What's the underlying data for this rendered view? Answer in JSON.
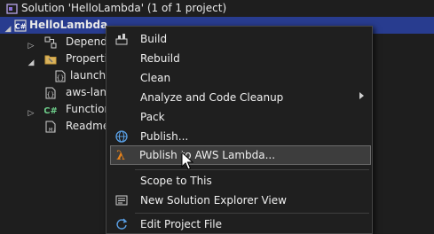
{
  "solution_explorer": {
    "solution_row": "Solution 'HelloLambda' (1 of 1 project)",
    "project_row": "HelloLambda",
    "items": [
      {
        "label": "Dependencies",
        "icon": "dependencies-icon"
      },
      {
        "label": "Properties",
        "icon": "properties-folder-icon"
      },
      {
        "label": "launchSettings.json",
        "icon": "json-file-icon"
      },
      {
        "label": "aws-lambda-tools-defaults.json",
        "icon": "json-file-icon"
      },
      {
        "label": "Function.cs",
        "icon": "csharp-file-icon"
      },
      {
        "label": "Readme.md",
        "icon": "markdown-file-icon"
      }
    ]
  },
  "context_menu": {
    "items": [
      {
        "label": "Build",
        "icon": "build-icon"
      },
      {
        "label": "Rebuild"
      },
      {
        "label": "Clean"
      },
      {
        "label": "Analyze and Code Cleanup",
        "submenu": true
      },
      {
        "label": "Pack"
      },
      {
        "label": "Publish...",
        "icon": "publish-globe-icon"
      },
      {
        "label": "Publish to AWS Lambda...",
        "icon": "aws-lambda-icon",
        "hovered": true
      },
      {
        "label": "Scope to This"
      },
      {
        "label": "New Solution Explorer View",
        "icon": "new-view-icon"
      },
      {
        "label": "Edit Project File",
        "icon": "edit-refresh-icon"
      }
    ]
  },
  "colors": {
    "background": "#1e1e1e",
    "selection": "#283c8f",
    "menu_background": "#1f1f1f",
    "menu_hover": "#3d3d3d",
    "lambda_orange": "#e8831a"
  }
}
